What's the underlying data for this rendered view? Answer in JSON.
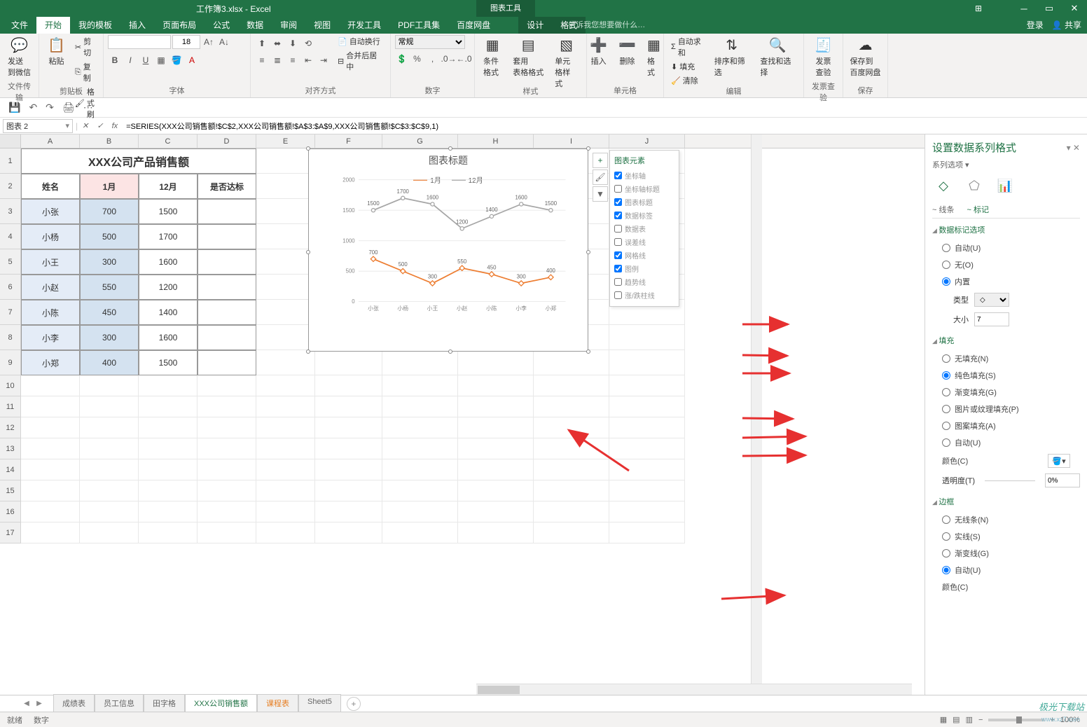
{
  "app": {
    "title": "工作簿3.xlsx - Excel",
    "context_tool": "图表工具",
    "login": "登录",
    "share": "共享"
  },
  "ribbon_tabs": [
    "文件",
    "开始",
    "我的模板",
    "插入",
    "页面布局",
    "公式",
    "数据",
    "审阅",
    "视图",
    "开发工具",
    "PDF工具集",
    "百度网盘",
    "设计",
    "格式"
  ],
  "ribbon_active": 1,
  "tell_me": "告诉我您想要做什么…",
  "ribbon": {
    "groups": {
      "file_transfer": "文件传输",
      "clipboard": "剪贴板",
      "font": "字体",
      "align": "对齐方式",
      "number": "数字",
      "styles": "样式",
      "cells": "单元格",
      "editing": "编辑",
      "invoice": "发票查验",
      "save": "保存"
    },
    "send_wechat": "发送\n到微信",
    "paste": "粘贴",
    "cut": "剪切",
    "copy": "复制",
    "format_painter": "格式刷",
    "font_size": "18",
    "wrap": "自动换行",
    "merge": "合并后居中",
    "number_format": "常规",
    "cond_fmt": "条件格式",
    "table_fmt": "套用\n表格格式",
    "cell_style": "单元格样式",
    "insert": "插入",
    "delete": "删除",
    "format": "格式",
    "autosum": "自动求和",
    "fill": "填充",
    "clear": "清除",
    "sort": "排序和筛选",
    "find": "查找和选择",
    "invoice_check": "发票\n查验",
    "save_baidu": "保存到\n百度网盘"
  },
  "name_box": "图表 2",
  "formula": "=SERIES(XXX公司销售额!$C$2,XXX公司销售额!$A$3:$A$9,XXX公司销售额!$C$3:$C$9,1)",
  "columns": [
    "A",
    "B",
    "C",
    "D",
    "E",
    "F",
    "G",
    "H",
    "I",
    "J"
  ],
  "table": {
    "title": "XXX公司产品销售额",
    "headers": [
      "姓名",
      "1月",
      "12月",
      "是否达标"
    ],
    "rows": [
      {
        "name": "小张",
        "m1": "700",
        "m12": "1500"
      },
      {
        "name": "小杨",
        "m1": "500",
        "m12": "1700"
      },
      {
        "name": "小王",
        "m1": "300",
        "m12": "1600"
      },
      {
        "name": "小赵",
        "m1": "550",
        "m12": "1200"
      },
      {
        "name": "小陈",
        "m1": "450",
        "m12": "1400"
      },
      {
        "name": "小李",
        "m1": "300",
        "m12": "1600"
      },
      {
        "name": "小郑",
        "m1": "400",
        "m12": "1500"
      }
    ]
  },
  "chart_data": {
    "type": "line",
    "title": "图表标题",
    "categories": [
      "小张",
      "小杨",
      "小王",
      "小赵",
      "小陈",
      "小李",
      "小郑"
    ],
    "series": [
      {
        "name": "1月",
        "values": [
          700,
          500,
          300,
          550,
          450,
          300,
          400
        ],
        "color": "#ed7d31"
      },
      {
        "name": "12月",
        "values": [
          1500,
          1700,
          1600,
          1200,
          1400,
          1600,
          1500
        ],
        "color": "#a6a6a6"
      }
    ],
    "ylim": [
      0,
      2000
    ],
    "yticks": [
      0,
      500,
      1000,
      1500,
      2000
    ]
  },
  "chart_elements": {
    "title": "图表元素",
    "items": [
      {
        "label": "坐标轴",
        "checked": true
      },
      {
        "label": "坐标轴标题",
        "checked": false
      },
      {
        "label": "图表标题",
        "checked": true
      },
      {
        "label": "数据标签",
        "checked": true
      },
      {
        "label": "数据表",
        "checked": false
      },
      {
        "label": "误差线",
        "checked": false
      },
      {
        "label": "网格线",
        "checked": true
      },
      {
        "label": "图例",
        "checked": true
      },
      {
        "label": "趋势线",
        "checked": false
      },
      {
        "label": "涨/跌柱线",
        "checked": false
      }
    ]
  },
  "format_pane": {
    "title": "设置数据系列格式",
    "subtitle": "系列选项 ▾",
    "tab_line": "线条",
    "tab_marker": "标记",
    "section_marker_options": "数据标记选项",
    "opt_auto": "自动(U)",
    "opt_none": "无(O)",
    "opt_builtin": "内置",
    "field_type": "类型",
    "field_size": "大小",
    "size_value": "7",
    "section_fill": "填充",
    "fill_none": "无填充(N)",
    "fill_solid": "纯色填充(S)",
    "fill_gradient": "渐变填充(G)",
    "fill_picture": "图片或纹理填充(P)",
    "fill_pattern": "图案填充(A)",
    "fill_auto": "自动(U)",
    "color_label": "颜色(C)",
    "transparency": "透明度(T)",
    "transparency_value": "0%",
    "section_border": "边框",
    "border_none": "无线条(N)",
    "border_solid": "实线(S)",
    "border_gradient": "渐变线(G)",
    "border_auto": "自动(U)",
    "border_color": "颜色(C)"
  },
  "sheet_tabs": [
    "成绩表",
    "员工信息",
    "田字格",
    "XXX公司销售额",
    "课程表",
    "Sheet5"
  ],
  "sheet_active": 3,
  "status": {
    "ready": "就绪",
    "mode": "数字",
    "zoom": "100%"
  },
  "watermark": "极光下载站",
  "watermark_url": "www.xz7.com"
}
